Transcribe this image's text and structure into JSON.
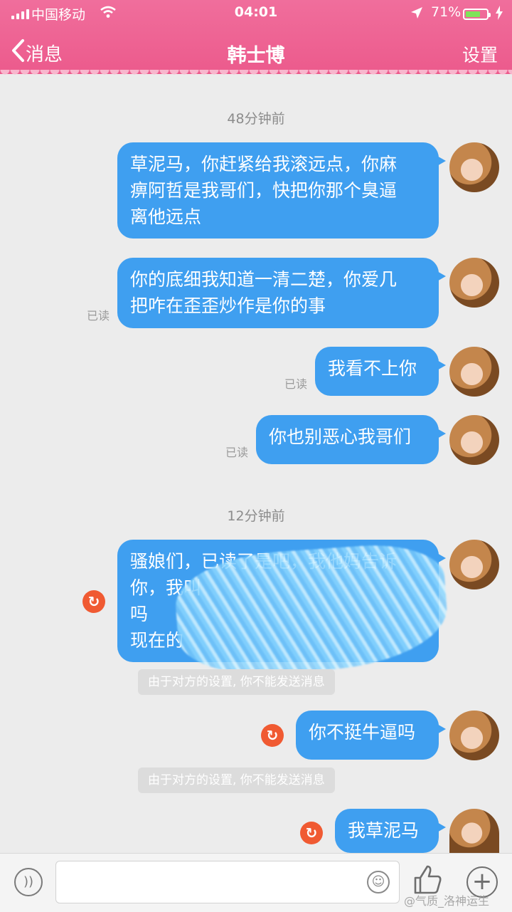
{
  "status_bar": {
    "carrier": "中国移动",
    "time": "04:01",
    "battery_percent": "71%",
    "battery_level": 0.71
  },
  "nav": {
    "back_label": "消息",
    "title": "韩士博",
    "settings_label": "设置"
  },
  "chat": {
    "timestamps": [
      "48分钟前",
      "12分钟前"
    ],
    "messages": [
      {
        "lines": [
          "草泥马，你赶紧给我滚远点，你麻",
          "痹阿哲是我哥们，快把你那个臭逼",
          "离他远点"
        ],
        "status": ""
      },
      {
        "lines": [
          "你的底细我知道一清二楚，你爱几",
          "把咋在歪歪炒作是你的事"
        ],
        "status": "已读"
      },
      {
        "lines": [
          "我看不上你"
        ],
        "status": "已读"
      },
      {
        "lines": [
          "你也别恶心我哥们"
        ],
        "status": "已读"
      },
      {
        "lines": [
          "骚娘们，已读了是吧，我他妈告诉",
          "你，我叫",
          "吗",
          "现在的"
        ],
        "status": ""
      },
      {
        "lines": [
          "你不挺牛逼吗"
        ],
        "status": ""
      },
      {
        "lines": [
          "我草泥马"
        ],
        "status": ""
      }
    ],
    "notices": [
      "由于对方的设置, 你不能发送消息",
      "由于对方的设置, 你不能发送消息"
    ]
  },
  "input_bar": {
    "placeholder": ""
  },
  "watermark": "@气质_洛神运生",
  "icons": {
    "back": "chevron-left-icon",
    "location": "location-arrow-icon",
    "voice": "voice-icon",
    "emoji": "emoji-icon",
    "like": "thumbs-up-icon",
    "plus": "plus-icon",
    "retry": "resend-icon"
  },
  "colors": {
    "header": "#ec5a8c",
    "bubble": "#3f9ff0",
    "retry": "#f05a32",
    "battery": "#7ee35a"
  }
}
